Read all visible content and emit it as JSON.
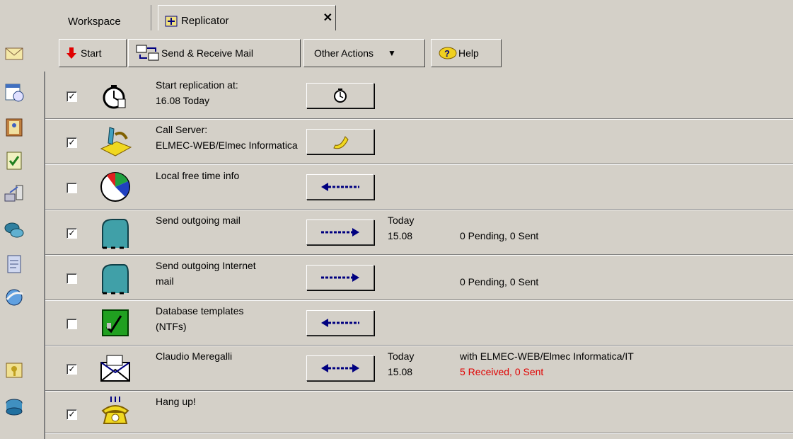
{
  "tabs": {
    "workspace": "Workspace",
    "replicator": "Replicator",
    "close": "✕"
  },
  "toolbar": {
    "start": "Start",
    "send_receive": "Send & Receive Mail",
    "other_actions": "Other Actions",
    "dropdown_arrow": "▼",
    "help": "Help"
  },
  "rows": [
    {
      "checked": true,
      "label1": "Start replication at:",
      "label2": "16.08 Today",
      "icon": "clock-icon",
      "button": "clock-icon"
    },
    {
      "checked": true,
      "label1": "Call Server:",
      "label2": "ELMEC-WEB/Elmec Informatica",
      "icon": "call-server-icon",
      "button": "phone-icon"
    },
    {
      "checked": false,
      "label1": "Local free time info",
      "label2": "",
      "icon": "pie-chart-icon",
      "button": "arrow-left-icon"
    },
    {
      "checked": true,
      "label1": "Send outgoing mail",
      "label2": "",
      "icon": "mailbox-icon",
      "button": "arrow-right-icon",
      "when1": "Today",
      "when2": "15.08",
      "status": "0 Pending, 0 Sent"
    },
    {
      "checked": false,
      "label1": "Send outgoing Internet",
      "label2": "mail",
      "icon": "mailbox-icon",
      "button": "arrow-right-icon",
      "status": "0 Pending, 0 Sent"
    },
    {
      "checked": false,
      "label1": "Database templates",
      "label2": "(NTFs)",
      "icon": "template-icon",
      "button": "arrow-left-icon"
    },
    {
      "checked": true,
      "label1": "Claudio Meregalli",
      "label2": "",
      "icon": "envelope-icon",
      "button": "arrow-both-icon",
      "when1": "Today",
      "when2": "15.08",
      "status1": "with ELMEC-WEB/Elmec Informatica/IT",
      "status2": "5 Received, 0 Sent"
    },
    {
      "checked": true,
      "label1": "Hang up!",
      "label2": "",
      "icon": "hangup-phone-icon",
      "button": ""
    }
  ],
  "check_mark": "✓",
  "colors": {
    "background": "#d4d0c8",
    "status_red": "#e00000",
    "arrow_blue": "#000080"
  }
}
